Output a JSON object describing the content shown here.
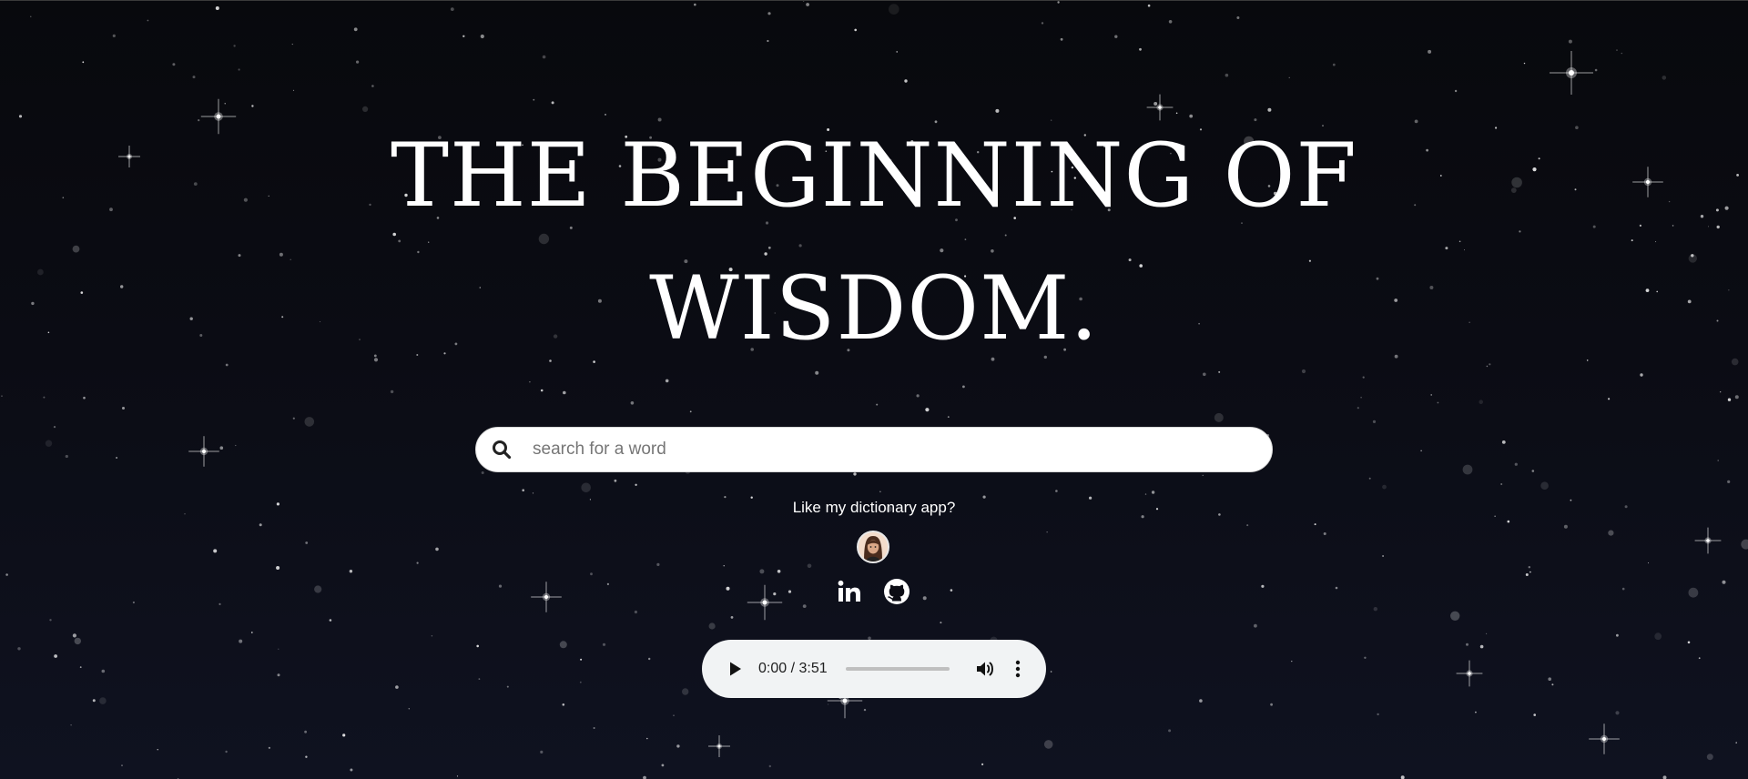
{
  "hero": {
    "title_line1": "THE BEGINNING OF",
    "title_line2": "WISDOM."
  },
  "search": {
    "placeholder": "search for a word",
    "value": "",
    "icon": "search-icon"
  },
  "promo": {
    "text": "Like my dictionary app?",
    "avatar_icon": "avatar-icon"
  },
  "social": [
    {
      "name": "LinkedIn",
      "icon": "linkedin-icon"
    },
    {
      "name": "GitHub",
      "icon": "github-icon"
    }
  ],
  "audio": {
    "time": "0:00 / 3:51",
    "progress": 0,
    "icons": [
      "play-icon",
      "volume-icon",
      "more-vert-icon"
    ]
  },
  "colors": {
    "background_top": "#08090d",
    "background_bottom": "#0f1220",
    "text": "#ffffff",
    "player_bg": "#f1f3f4",
    "search_bg": "#ffffff"
  }
}
